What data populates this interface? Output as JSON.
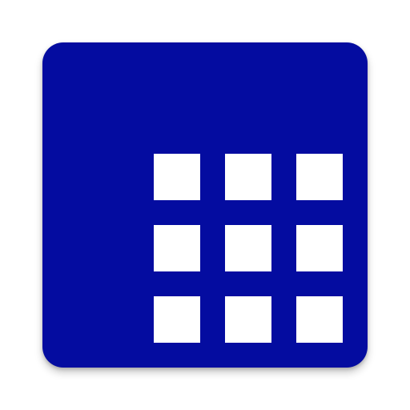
{
  "icon": {
    "name": "apps-grid-icon",
    "background_color": "#040ca0",
    "tile_color": "#ffffff",
    "tile_count": 9
  }
}
